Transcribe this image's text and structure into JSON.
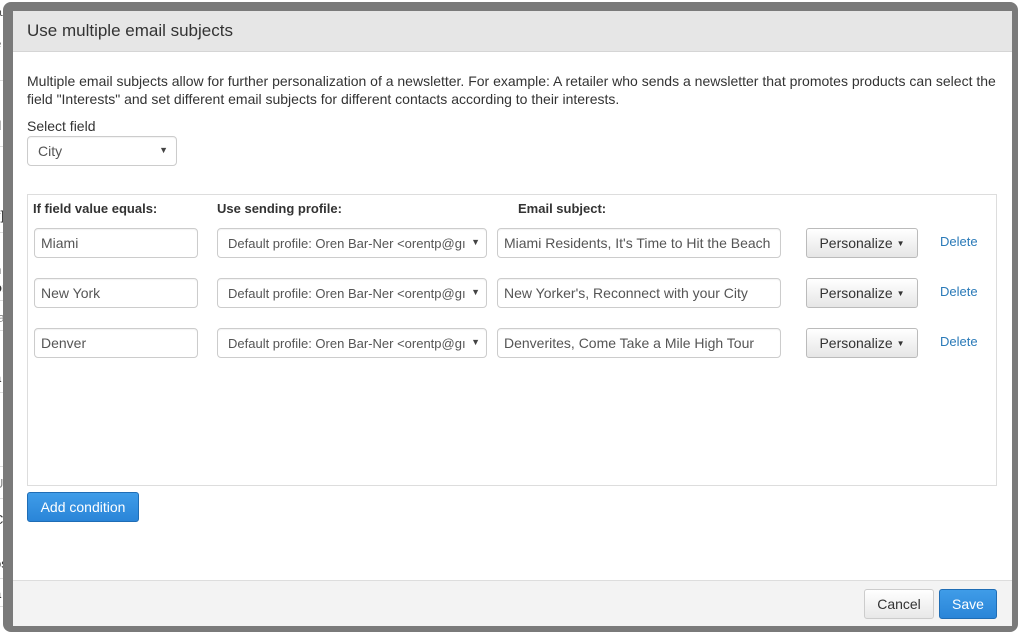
{
  "background": {
    "fragments": [
      "ou",
      "e",
      "d",
      "il",
      "y]",
      "n",
      "or",
      "fa",
      "a",
      "Il",
      "U",
      "C",
      "os",
      "a"
    ]
  },
  "modal": {
    "title": "Use multiple email subjects",
    "description": "Multiple email subjects allow for further personalization of a newsletter. For example: A retailer who sends a newsletter that promotes products can select the field \"Interests\" and set different email subjects for different contacts according to their interests.",
    "select_field": {
      "label": "Select field",
      "value": "City"
    },
    "columns": {
      "value": "If field value equals:",
      "profile": "Use sending profile:",
      "subject": "Email subject:"
    },
    "conditions": [
      {
        "value": "Miami",
        "profile": "Default profile: Oren Bar-Ner <orentp@gı",
        "subject": "Miami Residents, It's Time to Hit the Beach",
        "personalize_label": "Personalize",
        "delete_label": "Delete"
      },
      {
        "value": "New York",
        "profile": "Default profile: Oren Bar-Ner <orentp@gı",
        "subject": "New Yorker's, Reconnect with your City",
        "personalize_label": "Personalize",
        "delete_label": "Delete"
      },
      {
        "value": "Denver",
        "profile": "Default profile: Oren Bar-Ner <orentp@gı",
        "subject": "Denverites, Come Take a Mile High Tour",
        "personalize_label": "Personalize",
        "delete_label": "Delete"
      }
    ],
    "add_condition_label": "Add condition",
    "footer": {
      "cancel_label": "Cancel",
      "save_label": "Save"
    },
    "colors": {
      "primary": "#2a85d8",
      "link": "#2a7ab8",
      "header_bg": "#e6e6e6",
      "frame": "#7a7a7a"
    }
  }
}
